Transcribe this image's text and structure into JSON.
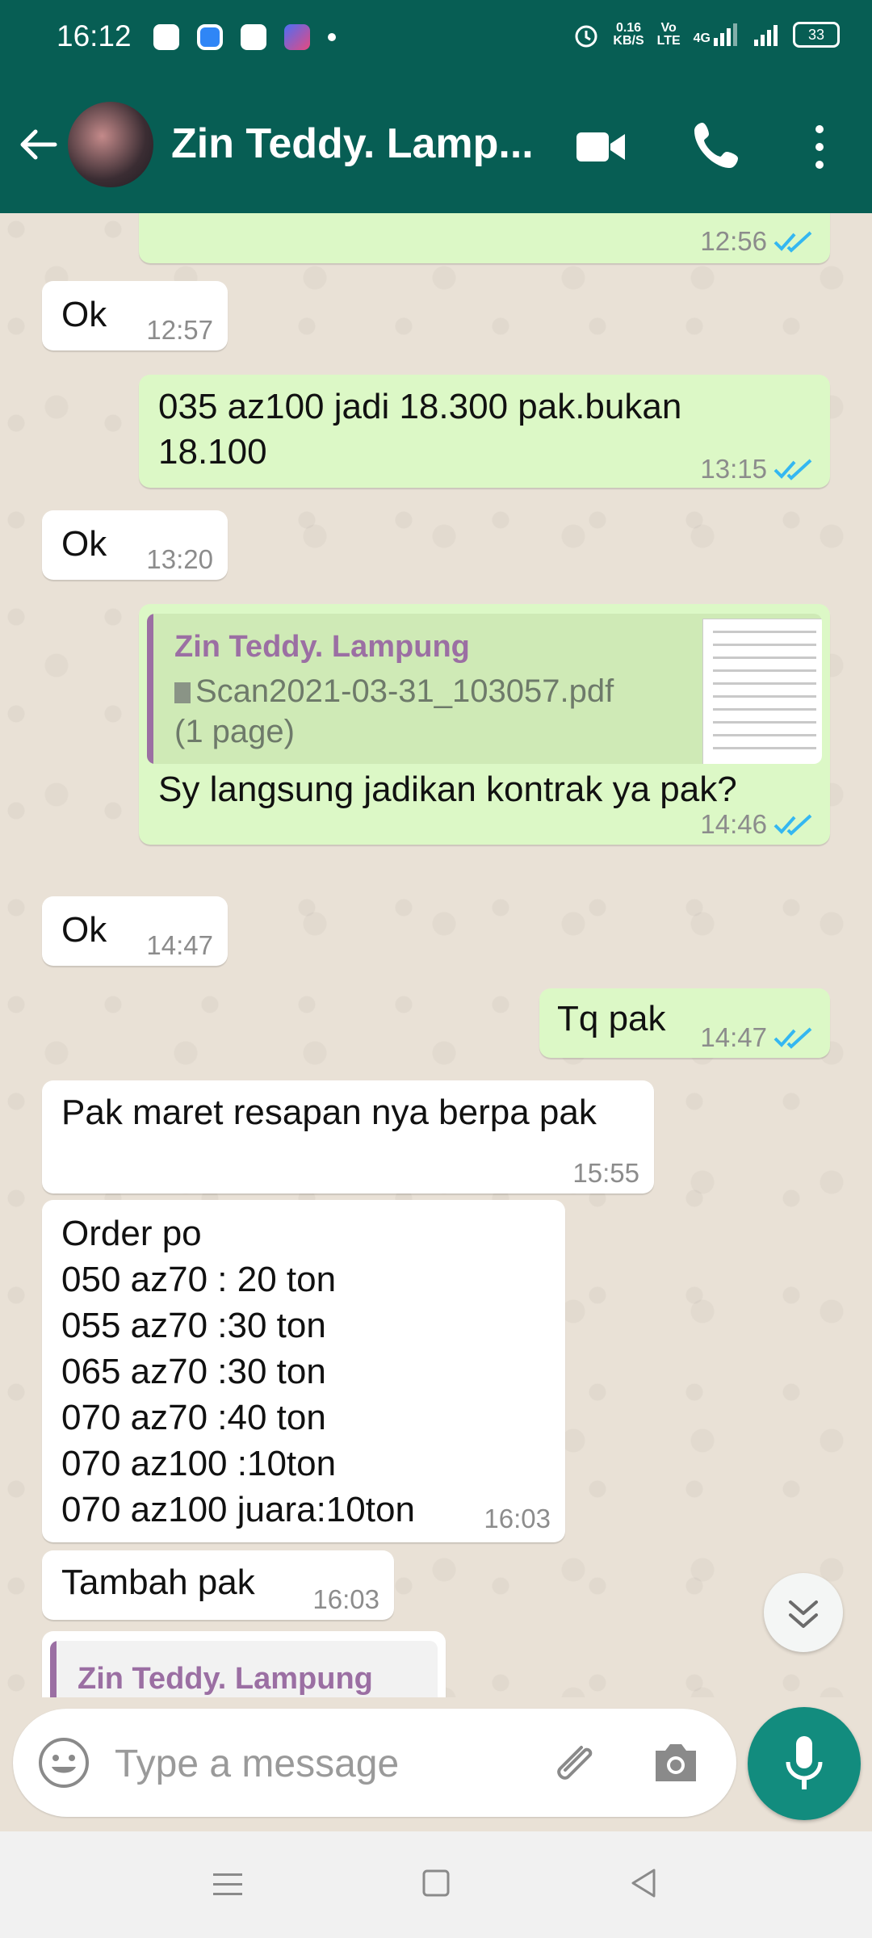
{
  "status_bar": {
    "time": "16:12",
    "speed": "0.16",
    "speed_unit": "KB/S",
    "volte_top": "Vo",
    "volte_bottom": "LTE",
    "network": "4G",
    "battery": "33"
  },
  "header": {
    "contact_name": "Zin Teddy. Lamp..."
  },
  "messages": [
    {
      "direction": "out",
      "text": "",
      "time": "12:56",
      "read": true
    },
    {
      "direction": "in",
      "text": "Ok",
      "time": "12:57"
    },
    {
      "direction": "out",
      "lines": [
        "035 az100 jadi 18.300 pak.bukan",
        "18.100"
      ],
      "time": "13:15",
      "read": true
    },
    {
      "direction": "in",
      "text": "Ok",
      "time": "13:20"
    },
    {
      "direction": "out",
      "quote": {
        "name": "Zin Teddy. Lampung",
        "file": "Scan2021-03-31_103057.pdf",
        "pages": "(1 page)"
      },
      "text": "Sy langsung jadikan kontrak ya pak?",
      "time": "14:46",
      "read": true
    },
    {
      "direction": "in",
      "text": "Ok",
      "time": "14:47"
    },
    {
      "direction": "out",
      "text": "Tq pak",
      "time": "14:47",
      "read": true
    },
    {
      "direction": "in",
      "text": "Pak maret resapan nya berpa pak",
      "time": "15:55"
    },
    {
      "direction": "in",
      "lines": [
        "Order po",
        "050 az70 : 20 ton",
        "055 az70 :30 ton",
        "065 az70 :30 ton",
        "070 az70 :40 ton",
        "070 az100 :10ton",
        "070 az100 juara:10ton"
      ],
      "time": "16:03"
    },
    {
      "direction": "in",
      "text": "Tambah pak",
      "time": "16:03"
    },
    {
      "direction": "in",
      "quote": {
        "name": "Zin Teddy. Lampung"
      }
    }
  ],
  "composer": {
    "placeholder": "Type a message"
  },
  "colors": {
    "header": "#075e54",
    "outgoing_bubble": "#dcf8c6",
    "incoming_bubble": "#ffffff",
    "read_ticks": "#34b7f1",
    "mic_button": "#128c7e"
  }
}
